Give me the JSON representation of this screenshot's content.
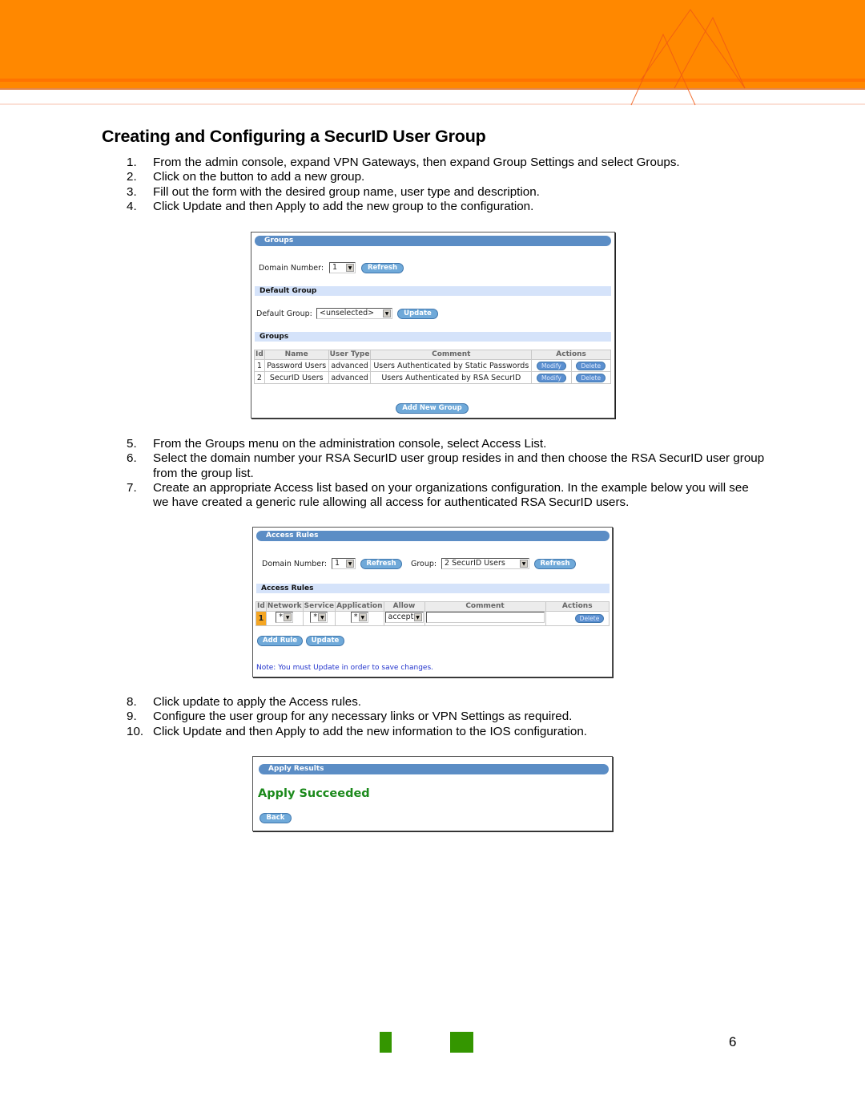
{
  "document": {
    "title": "Creating and Configuring a SecurID User Group",
    "page_number": "6",
    "brand_colors": {
      "header_orange": "#ff8800",
      "footer_green": "#349600"
    }
  },
  "steps_group_a": [
    {
      "num": "1.",
      "text": "From the admin console, expand VPN Gateways, then expand Group Settings and select Groups."
    },
    {
      "num": "2.",
      "text": "Click on the button to add a new group."
    },
    {
      "num": "3.",
      "text": "Fill out the form with the desired group name, user type and description."
    },
    {
      "num": "4.",
      "text": "Click Update and then Apply to add the new group to the configuration."
    }
  ],
  "steps_group_b": [
    {
      "num": "5.",
      "text": "From the Groups menu on the administration console, select Access List."
    },
    {
      "num": "6.",
      "text": "Select the domain number your RSA SecurID user group resides in and then choose the RSA SecurID user group from the group list."
    },
    {
      "num": "7.",
      "text": "Create an appropriate Access list based on your organizations configuration.  In the example below you will see we have created a generic rule allowing all access for authenticated RSA SecurID users."
    }
  ],
  "steps_group_c": [
    {
      "num": "8.",
      "text": "Click update to apply the Access rules."
    },
    {
      "num": "9.",
      "text": "Configure the user group for any necessary links or VPN Settings as required."
    },
    {
      "num": "10.",
      "text": "Click Update and then Apply to add the new information to the IOS configuration."
    }
  ],
  "groups_panel": {
    "title": "Groups",
    "domain_label": "Domain Number:",
    "domain_value": "1",
    "refresh_label": "Refresh",
    "default_group_section": "Default Group",
    "default_group_label": "Default Group:",
    "default_group_value": "<unselected>",
    "update_label": "Update",
    "groups_section": "Groups",
    "columns": [
      "Id",
      "Name",
      "User Type",
      "Comment",
      "Actions"
    ],
    "rows": [
      {
        "id": "1",
        "name": "Password Users",
        "user_type": "advanced",
        "comment": "Users Authenticated by Static Passwords",
        "modify": "Modify",
        "delete": "Delete"
      },
      {
        "id": "2",
        "name": "SecurID Users",
        "user_type": "advanced",
        "comment": "Users Authenticated by RSA SecurID",
        "modify": "Modify",
        "delete": "Delete"
      }
    ],
    "add_group_label": "Add New Group"
  },
  "access_panel": {
    "title": "Access Rules",
    "domain_label": "Domain Number:",
    "domain_value": "1",
    "refresh_label": "Refresh",
    "group_label": "Group:",
    "group_value": "2  SecurID Users",
    "refresh2_label": "Refresh",
    "section": "Access Rules",
    "columns": [
      "Id",
      "Network",
      "Service",
      "Application",
      "Allow",
      "Comment",
      "Actions"
    ],
    "rows": [
      {
        "id": "1",
        "network": "*",
        "service": "*",
        "application": "*",
        "allow": "accept",
        "comment": "",
        "delete": "Delete"
      }
    ],
    "add_rule_label": "Add Rule",
    "update_label": "Update",
    "note": "Note: You must Update in order to save changes."
  },
  "apply_panel": {
    "title": "Apply Results",
    "message": "Apply Succeeded",
    "back_label": "Back"
  }
}
